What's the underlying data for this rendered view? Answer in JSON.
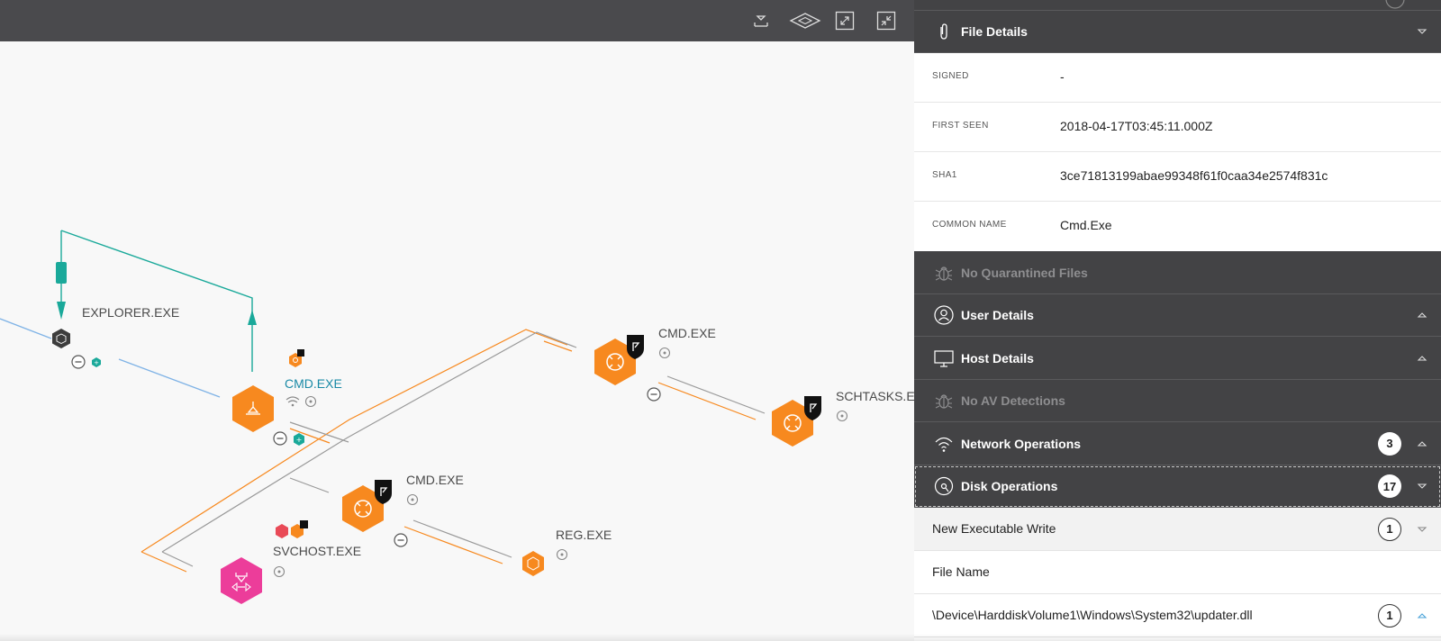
{
  "graph": {
    "nodes": {
      "explorer": "EXPLORER.EXE",
      "cmd_main": "CMD.EXE",
      "cmd_top": "CMD.EXE",
      "schtasks": "SCHTASKS.E",
      "cmd_bottom": "CMD.EXE",
      "svchost": "SVCHOST.EXE",
      "reg": "REG.EXE"
    }
  },
  "panel": {
    "file_details": {
      "title": "File Details",
      "rows": [
        {
          "key": "SIGNED",
          "value": "-"
        },
        {
          "key": "FIRST SEEN",
          "value": "2018-04-17T03:45:11.000Z"
        },
        {
          "key": "SHA1",
          "value": "3ce71813199abae99348f61f0caa34e2574f831c"
        },
        {
          "key": "COMMON NAME",
          "value": "Cmd.Exe"
        }
      ]
    },
    "sections": {
      "quarantined": "No Quarantined Files",
      "user": "User Details",
      "host": "Host Details",
      "av": "No AV Detections",
      "network": "Network Operations",
      "network_count": "3",
      "disk": "Disk Operations",
      "disk_count": "17"
    },
    "disk_ops": {
      "category": "New Executable Write",
      "category_count": "1",
      "column_header": "File Name",
      "file_path": "\\Device\\HarddiskVolume1\\Windows\\System32\\updater.dll",
      "file_count": "1"
    }
  },
  "colors": {
    "toolbar": "#4a4a4d",
    "panel_dark": "#434345",
    "node_orange": "#f7891f",
    "node_pink": "#ec3d9a",
    "teal": "#1aa99a",
    "edge_blue": "#7fb3e6"
  }
}
